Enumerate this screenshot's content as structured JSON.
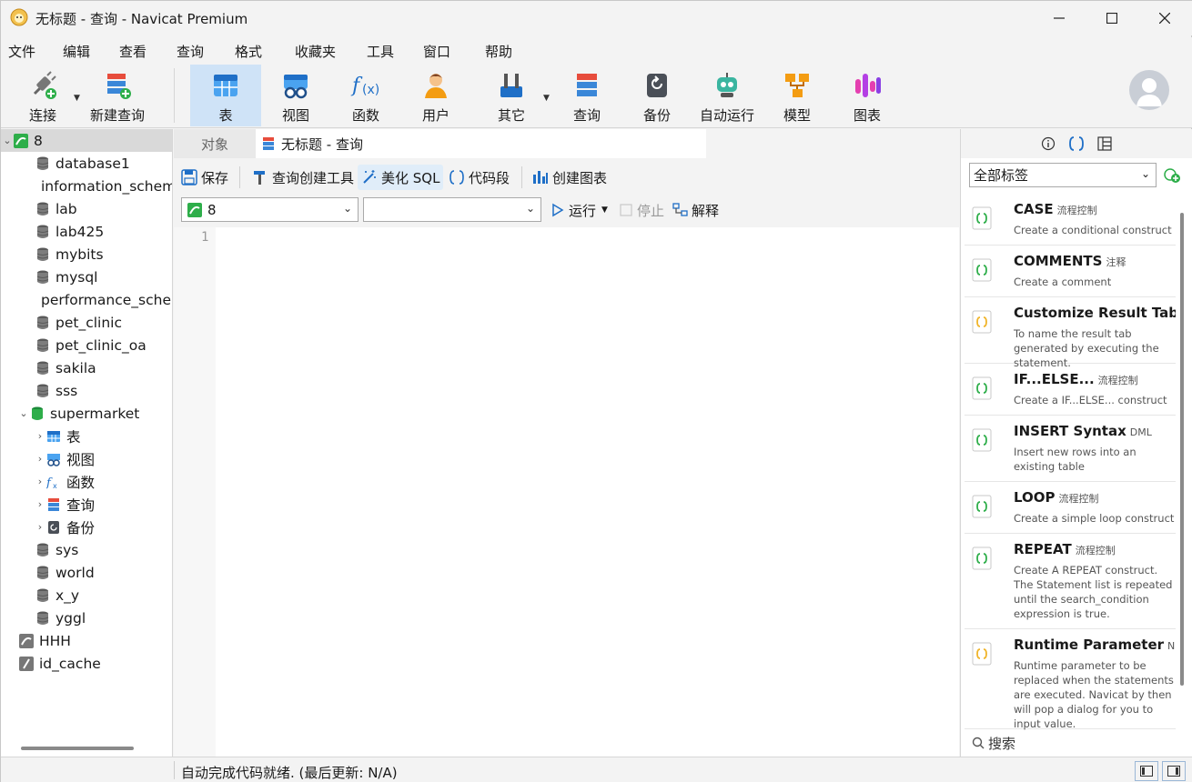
{
  "window": {
    "title": "无标题 - 查询 - Navicat Premium"
  },
  "menu": [
    "文件",
    "编辑",
    "查看",
    "查询",
    "格式",
    "收藏夹",
    "工具",
    "窗口",
    "帮助"
  ],
  "toolbar": {
    "connect": "连接",
    "new_query": "新建查询",
    "table": "表",
    "view": "视图",
    "function": "函数",
    "user": "用户",
    "other": "其它",
    "query": "查询",
    "backup": "备份",
    "automation": "自动运行",
    "model": "模型",
    "chart": "图表"
  },
  "tree": {
    "connection": "8",
    "databases": [
      "database1",
      "information_schema",
      "lab",
      "lab425",
      "mybits",
      "mysql",
      "performance_schema",
      "pet_clinic",
      "pet_clinic_oa",
      "sakila",
      "sss"
    ],
    "open_db": "supermarket",
    "open_children": [
      "表",
      "视图",
      "函数",
      "查询",
      "备份"
    ],
    "databases_after": [
      "sys",
      "world",
      "x_y",
      "yggl"
    ],
    "other_connections": [
      "HHH",
      "id_cache"
    ]
  },
  "tabs": {
    "objects": "对象",
    "current": "无标题 - 查询"
  },
  "query_toolbar": {
    "save": "保存",
    "builder": "查询创建工具",
    "beautify": "美化 SQL",
    "snippet": "代码段",
    "create_chart": "创建图表"
  },
  "selectors": {
    "connection": "8",
    "database": "",
    "run": "运行",
    "stop": "停止",
    "explain": "解释"
  },
  "editor": {
    "line_number": "1"
  },
  "right_panel": {
    "tag_filter": "全部标签",
    "search_placeholder": "搜索",
    "snippets": [
      {
        "name": "CASE",
        "tag": "流程控制",
        "desc": "Create a conditional construct"
      },
      {
        "name": "COMMENTS",
        "tag": "注释",
        "desc": "Create a comment"
      },
      {
        "name": "Customize Result Tab Name",
        "tag": "",
        "desc": "To name the result tab generated by executing the statement."
      },
      {
        "name": "IF...ELSE...",
        "tag": "流程控制",
        "desc": "Create a IF...ELSE... construct"
      },
      {
        "name": "INSERT Syntax",
        "tag": "DML",
        "desc": "Insert new rows into an existing table"
      },
      {
        "name": "LOOP",
        "tag": "流程控制",
        "desc": "Create a simple loop construct"
      },
      {
        "name": "REPEAT",
        "tag": "流程控制",
        "desc": "Create A REPEAT construct. The Statement list is repeated until the search_condition expression is true."
      },
      {
        "name": "Runtime Parameter",
        "tag": "Navicat",
        "desc": "Runtime parameter to be replaced when the statements are executed. Navicat by then will pop a dialog for you to input value."
      }
    ]
  },
  "status": {
    "text": "自动完成代码就绪. (最后更新: N/A)"
  }
}
